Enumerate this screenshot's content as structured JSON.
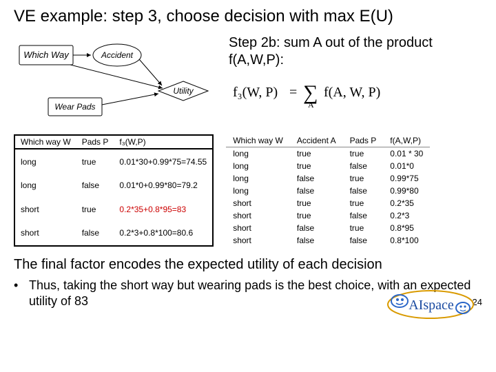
{
  "title": "VE example: step 3, choose decision with max E(U)",
  "diagram": {
    "which_way": "Which Way",
    "accident": "Accident",
    "utility": "Utility",
    "wear_pads": "Wear Pads"
  },
  "step2b": "Step 2b: sum A out of the product f(A,W,P):",
  "formula": {
    "lhs": "f₃(W, P)",
    "eq": "=",
    "sum": "∑",
    "sub": "A",
    "rhs": "f(A, W, P)"
  },
  "left_table": {
    "headers": [
      "Which way W",
      "Pads P",
      "f₃(W,P)"
    ],
    "rows": [
      {
        "w": "long",
        "p": "true",
        "f": "0.01*30+0.99*75=74.55"
      },
      {
        "w": "long",
        "p": "false",
        "f": "0.01*0+0.99*80=79.2"
      },
      {
        "w": "short",
        "p": "true",
        "f": "0.2*35+0.8*95=83",
        "hl": true
      },
      {
        "w": "short",
        "p": "false",
        "f": "0.2*3+0.8*100=80.6"
      }
    ]
  },
  "right_table": {
    "headers": [
      "Which way W",
      "Accident A",
      "Pads P",
      "f(A,W,P)"
    ],
    "rows": [
      {
        "w": "long",
        "a": "true",
        "p": "true",
        "f": "0.01 * 30"
      },
      {
        "w": "long",
        "a": "true",
        "p": "false",
        "f": "0.01*0"
      },
      {
        "w": "long",
        "a": "false",
        "p": "true",
        "f": "0.99*75"
      },
      {
        "w": "long",
        "a": "false",
        "p": "false",
        "f": "0.99*80"
      },
      {
        "w": "short",
        "a": "true",
        "p": "true",
        "f": "0.2*35"
      },
      {
        "w": "short",
        "a": "true",
        "p": "false",
        "f": "0.2*3"
      },
      {
        "w": "short",
        "a": "false",
        "p": "true",
        "f": "0.8*95"
      },
      {
        "w": "short",
        "a": "false",
        "p": "false",
        "f": "0.8*100"
      }
    ]
  },
  "final_note": "The final factor encodes the expected utility of each decision",
  "logo_text": "AIspace",
  "bullet": "Thus, taking the short way but wearing pads is the best choice, with an expected utility of 83",
  "page_number": "24"
}
